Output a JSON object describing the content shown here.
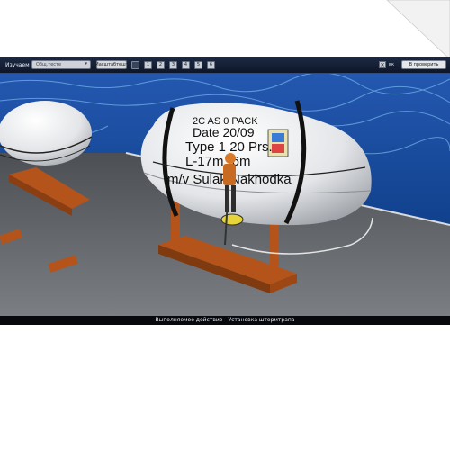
{
  "toolbar": {
    "mode_label": "Изучаем",
    "mode_select_value": "Общ.тесте",
    "scale_button": "Масштабтешт",
    "tool_labels": [
      "1",
      "2",
      "3",
      "4",
      "5",
      "6"
    ],
    "sound_label": "вк",
    "exit_button": "В проверить"
  },
  "scene": {
    "raft_text_lines": [
      "2C AS 0 PACK",
      "Date 20/09",
      "Type 1 20 Prs.",
      "L-17m    -6m",
      "m/v Sulak Nakhodka"
    ]
  },
  "status": {
    "text": "Выполняемое действие - Установка штормтрапа"
  },
  "colors": {
    "sea": "#1a4fa0",
    "deck": "#6b6e72",
    "raft": "#e8eaec",
    "cradle": "#b4541a"
  }
}
